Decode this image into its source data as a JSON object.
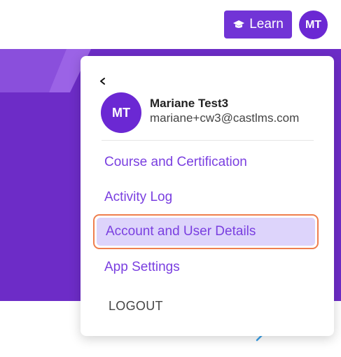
{
  "header": {
    "learn_label": "Learn",
    "avatar_initials": "MT"
  },
  "colors": {
    "brand_purple": "#6d2cc7",
    "menu_text": "#7a3fe0",
    "highlight_bg": "#ddd4fb",
    "highlight_border": "#ef7e4e"
  },
  "dropdown": {
    "back_icon": "chevron-left-icon",
    "avatar_initials": "MT",
    "user_name": "Mariane Test3",
    "user_email": "mariane+cw3@castlms.com",
    "items": [
      {
        "label": "Course and Certification"
      },
      {
        "label": "Activity Log"
      },
      {
        "label": "Account and User Details",
        "highlighted": true
      },
      {
        "label": "App Settings"
      }
    ],
    "logout_label": "LOGOUT"
  }
}
